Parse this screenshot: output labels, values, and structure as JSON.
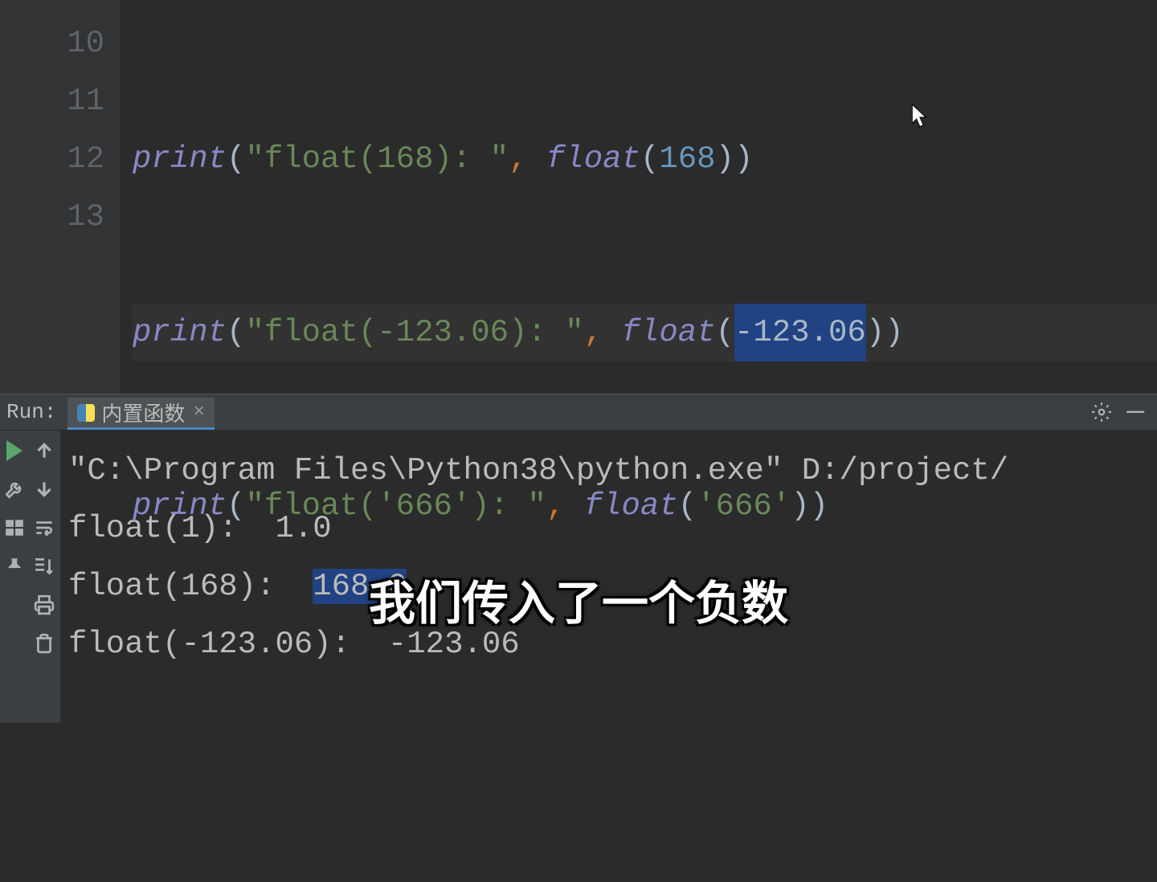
{
  "gutter": {
    "lines": [
      "10",
      "11",
      "12",
      "13"
    ]
  },
  "code": {
    "line10": {
      "print": "print",
      "p1": "(",
      "str": "\"float(168): \"",
      "comma": ",",
      "sp": " ",
      "fn": "float",
      "p2": "(",
      "num": "168",
      "p3": ")",
      "p4": ")"
    },
    "line11": {
      "print": "print",
      "p1": "(",
      "str": "\"float(-123.06): \"",
      "comma": ",",
      "sp": " ",
      "fn": "float",
      "p2": "(",
      "num_sel": "-123.06",
      "p3": ")",
      "p4": ")"
    },
    "line12": {
      "print": "print",
      "p1": "(",
      "str": "\"float('666'): \"",
      "comma": ",",
      "sp": " ",
      "fn": "float",
      "p2": "(",
      "arg": "'666'",
      "p3": ")",
      "p4": ")"
    }
  },
  "run": {
    "label": "Run:",
    "tab_name": "内置函数",
    "tab_close": "×"
  },
  "console": {
    "line1": "\"C:\\Program Files\\Python38\\python.exe\" D:/project/",
    "line2": "float(1):  1.0",
    "line3_pre": "float(168):  ",
    "line3_sel": "168.0",
    "line4": "float(-123.06):  -123.06"
  },
  "subtitle": "我们传入了一个负数"
}
